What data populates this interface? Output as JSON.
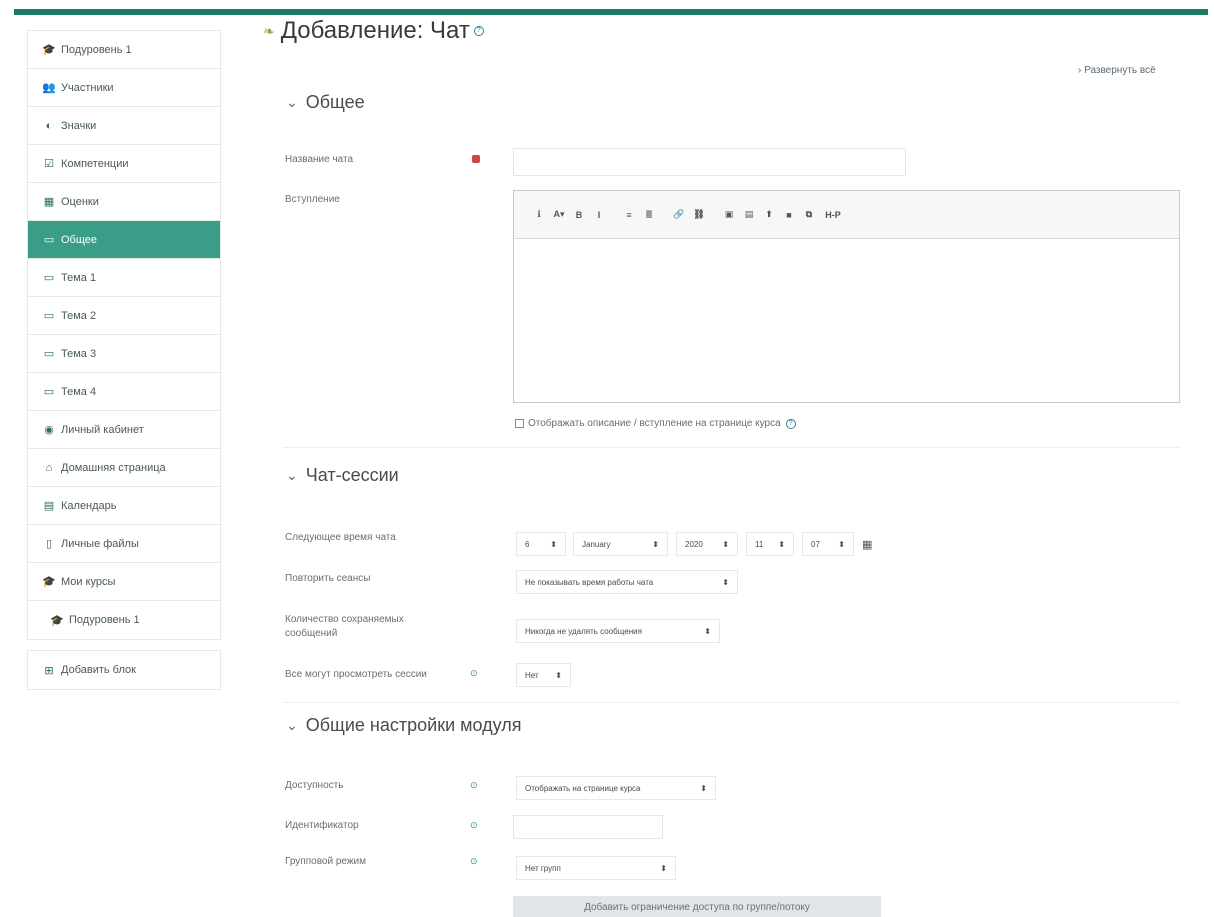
{
  "colors": {
    "accent": "#3a9d88",
    "top_bar": "#1b7a63",
    "required": "#d64545"
  },
  "sidebar": {
    "groups": [
      {
        "items": [
          {
            "icon": "graduation-cap-icon",
            "glyph": "🎓",
            "label": "Подуровень 1"
          },
          {
            "icon": "users-icon",
            "glyph": "👥",
            "label": "Участники"
          },
          {
            "icon": "badge-icon",
            "glyph": "◐",
            "label": "Значки"
          },
          {
            "icon": "checklist-icon",
            "glyph": "☑",
            "label": "Компетенции"
          },
          {
            "icon": "grades-icon",
            "glyph": "▦",
            "label": "Оценки"
          },
          {
            "icon": "folder-icon",
            "glyph": "▭",
            "label": "Общее",
            "active": true
          },
          {
            "icon": "folder-icon",
            "glyph": "▭",
            "label": "Тема 1"
          },
          {
            "icon": "folder-icon",
            "glyph": "▭",
            "label": "Тема 2"
          },
          {
            "icon": "folder-icon",
            "glyph": "▭",
            "label": "Тема 3"
          },
          {
            "icon": "folder-icon",
            "glyph": "▭",
            "label": "Тема 4"
          },
          {
            "icon": "dashboard-icon",
            "glyph": "◉",
            "label": "Личный кабинет"
          },
          {
            "icon": "home-icon",
            "glyph": "⌂",
            "label": "Домашняя страница"
          },
          {
            "icon": "calendar-icon",
            "glyph": "▤",
            "label": "Календарь"
          },
          {
            "icon": "file-icon",
            "glyph": "▯",
            "label": "Личные файлы"
          },
          {
            "icon": "graduation-cap-icon",
            "glyph": "🎓",
            "label": "Мои курсы"
          },
          {
            "icon": "graduation-cap-icon",
            "glyph": "🎓",
            "label": "Подуровень 1",
            "indent": true
          }
        ]
      },
      {
        "items": [
          {
            "icon": "plus-square-icon",
            "glyph": "⊞",
            "label": "Добавить блок"
          }
        ]
      }
    ]
  },
  "page": {
    "title": "Добавление: Чат",
    "expand_all": "› Развернуть всё"
  },
  "general": {
    "title": "Общее",
    "name_label": "Название чата",
    "intro_label": "Вступление",
    "show_desc_label": "Отображать описание / вступление на странице курса",
    "toolbar": [
      [
        "ℹ",
        "A▾",
        "B",
        "I"
      ],
      [
        "≡",
        "≣"
      ],
      [
        "🔗",
        "⛓"
      ],
      [
        "▣",
        "▤",
        "⬆",
        "■",
        "⧉",
        "H-P"
      ]
    ]
  },
  "chat_sessions": {
    "title": "Чат-сессии",
    "next_time_label": "Следующее время чата",
    "day": "6",
    "month": "January",
    "year": "2020",
    "hour": "11",
    "minute": "07",
    "repeat_label": "Повторить сеансы",
    "repeat_value": "Не показывать время работы чата",
    "keep_label": "Количество сохраняемых сообщений",
    "keep_value": "Никогда не удалять сообщения",
    "view_label": "Все могут просмотреть сессии",
    "view_value": "Нет"
  },
  "module_settings": {
    "title": "Общие настройки модуля",
    "availability_label": "Доступность",
    "availability_value": "Отображать на странице курса",
    "id_label": "Идентификатор",
    "group_mode_label": "Групповой режим",
    "group_mode_value": "Нет групп",
    "restrict_button": "Добавить ограничение доступа по группе/потоку"
  }
}
